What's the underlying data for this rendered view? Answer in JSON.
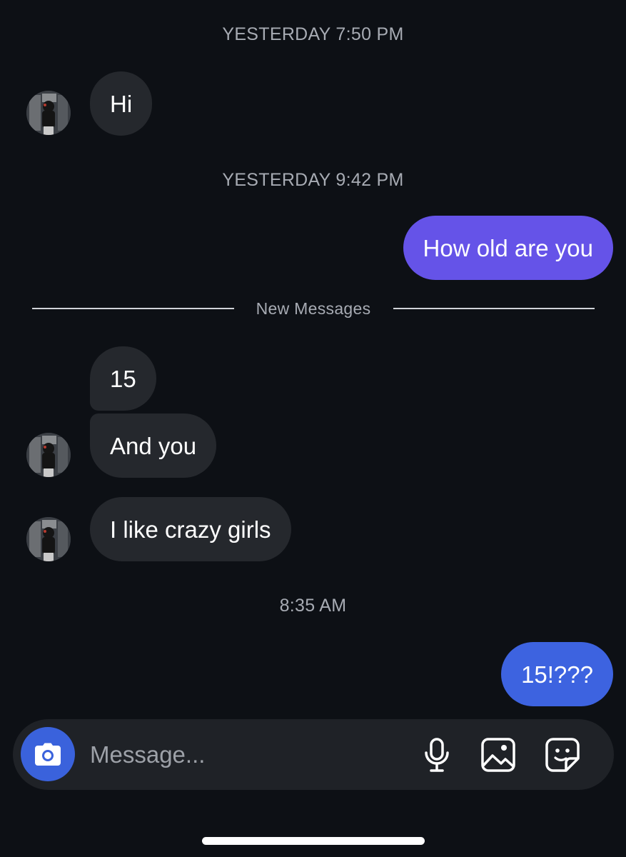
{
  "timestamps": {
    "first": "YESTERDAY 7:50 PM",
    "second": "YESTERDAY 9:42 PM",
    "third": "8:35 AM"
  },
  "messages": [
    {
      "direction": "incoming",
      "text": "Hi"
    },
    {
      "direction": "outgoing",
      "text": "How old are you"
    },
    {
      "direction": "incoming",
      "text": "15"
    },
    {
      "direction": "incoming",
      "text": "And you"
    },
    {
      "direction": "incoming",
      "text": "I like crazy girls"
    },
    {
      "direction": "outgoing",
      "text": "15!???"
    }
  ],
  "divider": {
    "label": "New Messages"
  },
  "composer": {
    "placeholder": "Message...",
    "icons": [
      "camera-icon",
      "microphone-icon",
      "gallery-icon",
      "sticker-icon"
    ]
  },
  "colors": {
    "background": "#0d1015",
    "incoming_bubble": "#25282d",
    "outgoing_bubble_1": "#6553e8",
    "outgoing_bubble_2": "#3d63e0",
    "camera_button": "#3a62dc"
  }
}
